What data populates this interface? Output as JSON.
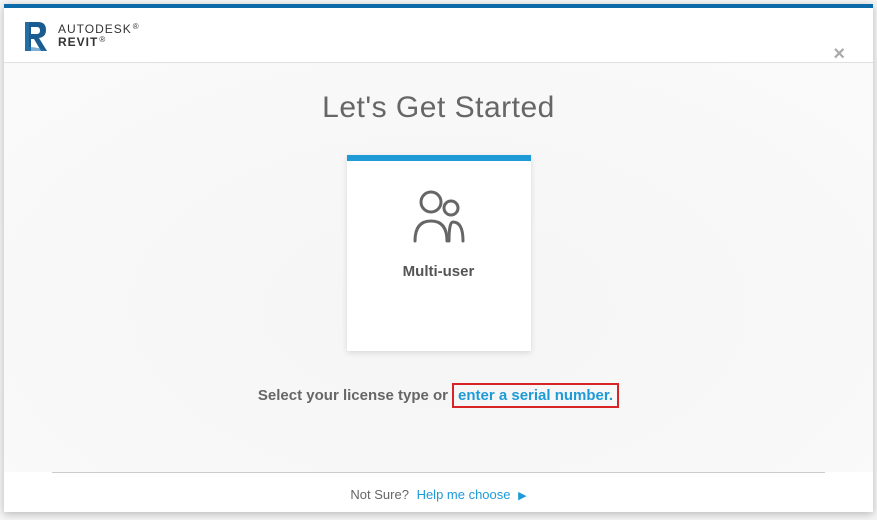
{
  "header": {
    "brand": "AUTODESK",
    "product": "REVIT"
  },
  "main": {
    "title": "Let's Get Started",
    "card_label": "Multi-user",
    "instruction_prefix": "Select your license type or",
    "serial_link": "enter a serial number."
  },
  "footer": {
    "prefix": "Not Sure?",
    "link": "Help me choose"
  }
}
